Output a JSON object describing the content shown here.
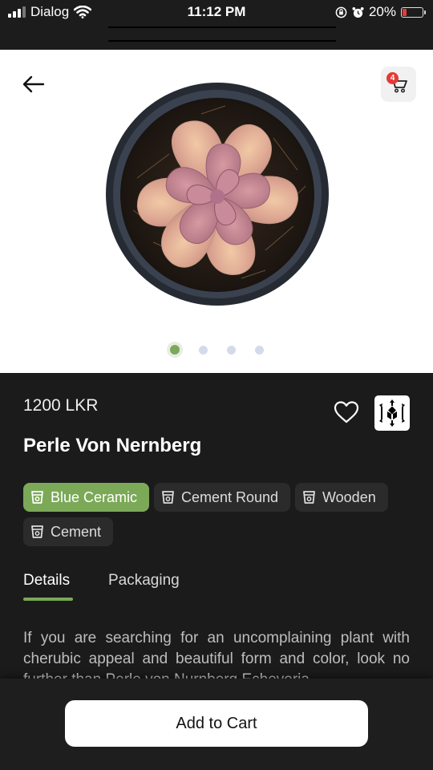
{
  "status_bar": {
    "carrier": "Dialog",
    "time": "11:12 PM",
    "battery_percent": "20%",
    "battery_level": 0.2,
    "icons": [
      "signal-icon",
      "wifi-icon",
      "orientation-lock-icon",
      "alarm-icon",
      "battery-icon"
    ]
  },
  "hero": {
    "back_icon": "arrow-left-icon",
    "cart_icon": "cart-icon",
    "cart_count": "4",
    "image_pages": 4,
    "active_page": 0
  },
  "product": {
    "price": "1200 LKR",
    "name": "Perle Von Nernberg",
    "favorite_icon": "heart-outline-icon",
    "ar_icon": "ar-view-icon"
  },
  "pot_options": [
    {
      "label": "Blue Ceramic",
      "selected": true
    },
    {
      "label": "Cement Round",
      "selected": false
    },
    {
      "label": "Wooden",
      "selected": false
    },
    {
      "label": "Cement",
      "selected": false
    }
  ],
  "tabs": {
    "details": "Details",
    "packaging": "Packaging",
    "active": "Details"
  },
  "description": "If you are searching for an uncomplaining plant with cherubic appeal and beautiful form and color, look no further than Perle von Nurnberg Echeveria.",
  "footer": {
    "add_to_cart": "Add to Cart"
  },
  "colors": {
    "accent": "#7ba957",
    "background": "#1b1b1b",
    "badge": "#e53935"
  }
}
